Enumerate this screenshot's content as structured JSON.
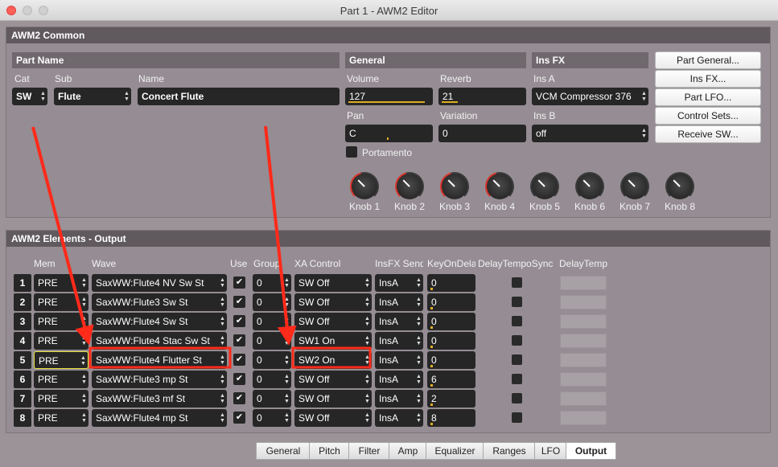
{
  "window": {
    "title": "Part 1 - AWM2 Editor"
  },
  "common": {
    "heading": "AWM2 Common",
    "part_name": {
      "heading": "Part Name",
      "cat_label": "Cat",
      "sub_label": "Sub",
      "name_label": "Name",
      "cat_value": "SW",
      "sub_value": "Flute",
      "name_value": "Concert Flute"
    },
    "general": {
      "heading": "General",
      "volume_label": "Volume",
      "volume_value": "127",
      "volume_level": 0.95,
      "reverb_label": "Reverb",
      "reverb_value": "21",
      "reverb_level": 0.2,
      "pan_label": "Pan",
      "pan_value": "C",
      "variation_label": "Variation",
      "variation_value": "0",
      "portamento_label": "Portamento"
    },
    "ins_fx": {
      "heading": "Ins FX",
      "ins_a_label": "Ins A",
      "ins_a_value": "VCM Compressor 376",
      "ins_b_label": "Ins B",
      "ins_b_value": "off"
    },
    "buttons": [
      "Part General...",
      "Ins FX...",
      "Part LFO...",
      "Control Sets...",
      "Receive SW..."
    ],
    "knobs": [
      "Knob 1",
      "Knob 2",
      "Knob 3",
      "Knob 4",
      "Knob 5",
      "Knob 6",
      "Knob 7",
      "Knob 8"
    ]
  },
  "elements": {
    "heading": "AWM2 Elements - Output",
    "columns": [
      "Mem",
      "Wave",
      "Use",
      "Group",
      "XA Control",
      "InsFX Send",
      "KeyOnDelay",
      "DelayTempoSync",
      "DelayTempo"
    ],
    "rows": [
      {
        "num": "1",
        "mem": "PRE",
        "wave": "SaxWW:Flute4 NV Sw St",
        "use": "✔",
        "group": "0",
        "xa": "SW Off",
        "insfx": "InsA",
        "keyon": "0"
      },
      {
        "num": "2",
        "mem": "PRE",
        "wave": "SaxWW:Flute3 Sw St",
        "use": "✔",
        "group": "0",
        "xa": "SW Off",
        "insfx": "InsA",
        "keyon": "0"
      },
      {
        "num": "3",
        "mem": "PRE",
        "wave": "SaxWW:Flute4 Sw St",
        "use": "✔",
        "group": "0",
        "xa": "SW Off",
        "insfx": "InsA",
        "keyon": "0"
      },
      {
        "num": "4",
        "mem": "PRE",
        "wave": "SaxWW:Flute4 Stac Sw St",
        "use": "✔",
        "group": "0",
        "xa": "SW1 On",
        "insfx": "InsA",
        "keyon": "0"
      },
      {
        "num": "5",
        "mem": "PRE",
        "wave": "SaxWW:Flute4 Flutter St",
        "use": "✔",
        "group": "0",
        "xa": "SW2 On",
        "insfx": "InsA",
        "keyon": "0"
      },
      {
        "num": "6",
        "mem": "PRE",
        "wave": "SaxWW:Flute3 mp St",
        "use": "✔",
        "group": "0",
        "xa": "SW Off",
        "insfx": "InsA",
        "keyon": "6"
      },
      {
        "num": "7",
        "mem": "PRE",
        "wave": "SaxWW:Flute3 mf St",
        "use": "✔",
        "group": "0",
        "xa": "SW Off",
        "insfx": "InsA",
        "keyon": "2"
      },
      {
        "num": "8",
        "mem": "PRE",
        "wave": "SaxWW:Flute4 mp St",
        "use": "✔",
        "group": "0",
        "xa": "SW Off",
        "insfx": "InsA",
        "keyon": "8"
      }
    ]
  },
  "tabs": [
    "General",
    "Pitch",
    "Filter",
    "Amp",
    "Equalizer",
    "Ranges",
    "LFO",
    "Output"
  ],
  "active_tab": "Output",
  "colors": {
    "accent": "#e0ad21",
    "annotation": "#ff2a1a",
    "knob_active": "#d9342b"
  }
}
